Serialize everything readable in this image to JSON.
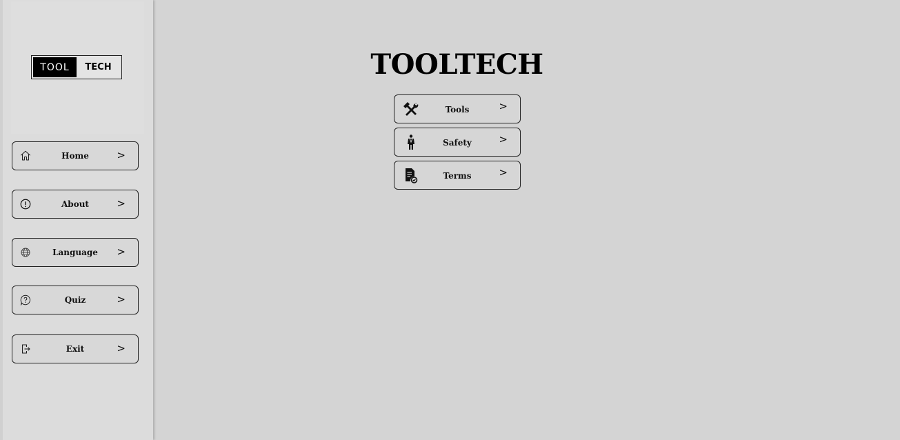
{
  "logo": {
    "left_text": "TOOL",
    "right_text": "TECH"
  },
  "sidebar": {
    "items": [
      {
        "label": "Home",
        "icon": "home-icon"
      },
      {
        "label": "About",
        "icon": "info-icon"
      },
      {
        "label": "Language",
        "icon": "globe-icon"
      },
      {
        "label": "Quiz",
        "icon": "question-icon"
      },
      {
        "label": "Exit",
        "icon": "exit-icon"
      }
    ],
    "chevron": ">"
  },
  "main": {
    "title": "TOOLTECH",
    "menu": [
      {
        "label": "Tools",
        "icon": "tools-icon"
      },
      {
        "label": "Safety",
        "icon": "worker-icon"
      },
      {
        "label": "Terms",
        "icon": "document-check-icon"
      }
    ],
    "chevron": ">"
  },
  "colors": {
    "background": "#d4d4d4",
    "sidebar": "#dcdcdc",
    "logo_dark": "#000000"
  }
}
